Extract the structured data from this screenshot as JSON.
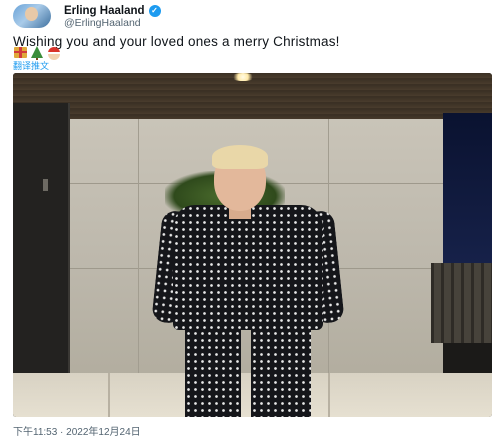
{
  "author": {
    "display_name": "Erling Haaland",
    "handle": "@ErlingHaaland",
    "verified_icon": "verified-badge-icon",
    "verified_color": "#1d9bf0"
  },
  "tweet": {
    "text": "Wishing you and your loved ones a merry Christmas!",
    "emojis": [
      "gift-icon",
      "christmas-tree-icon",
      "santa-icon"
    ],
    "translate_label": "翻译推文",
    "timestamp": "下午11:53 · 2022年12月24日"
  },
  "media": {
    "type": "photo"
  },
  "colors": {
    "link": "#1d9bf0",
    "secondary_text": "#536471",
    "primary_text": "#0f1419"
  }
}
